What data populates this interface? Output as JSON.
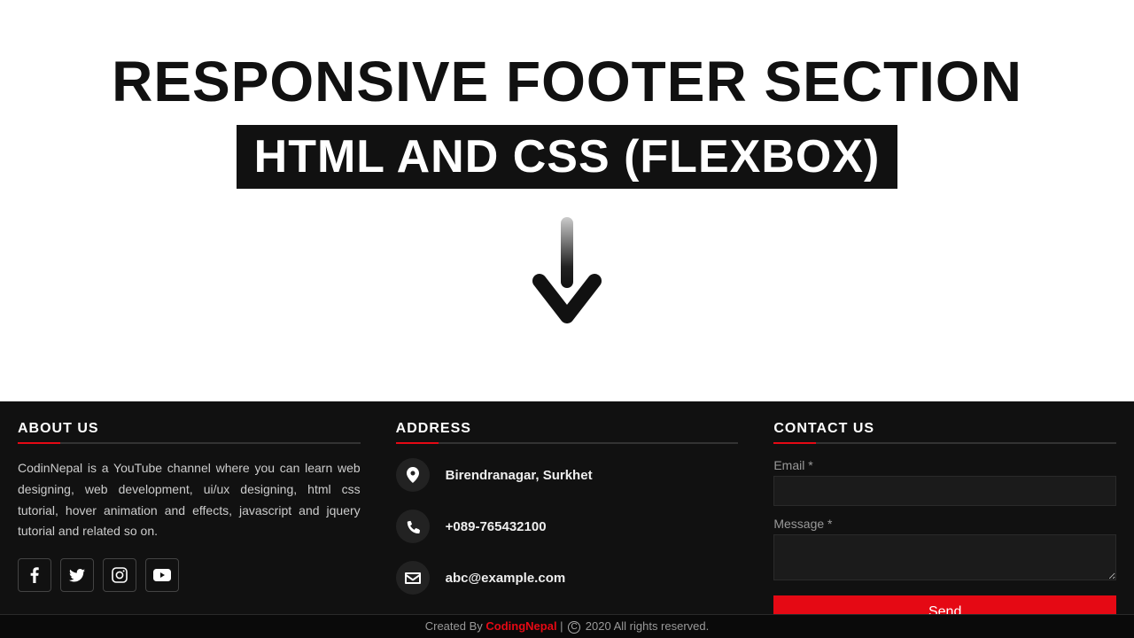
{
  "hero": {
    "line1": "RESPONSIVE FOOTER SECTION",
    "line2": "HTML AND CSS (FLEXBOX)"
  },
  "footer": {
    "about": {
      "title": "ABOUT US",
      "text": "CodinNepal is a YouTube channel where you can learn web designing, web development, ui/ux designing, html css tutorial, hover animation and effects, javascript and jquery tutorial and related so on."
    },
    "address": {
      "title": "ADDRESS",
      "location": "Birendranagar, Surkhet",
      "phone": "+089-765432100",
      "email": "abc@example.com"
    },
    "contact": {
      "title": "CONTACT US",
      "email_label": "Email *",
      "message_label": "Message *",
      "send_label": "Send"
    }
  },
  "bottom": {
    "created_by": "Created By ",
    "brand": "CodingNepal",
    "sep": " | ",
    "rights": " 2020 All rights reserved."
  },
  "icons": {
    "facebook": "facebook-icon",
    "twitter": "twitter-icon",
    "instagram": "instagram-icon",
    "youtube": "youtube-icon",
    "location": "location-pin-icon",
    "phone": "phone-icon",
    "envelope": "envelope-icon"
  }
}
